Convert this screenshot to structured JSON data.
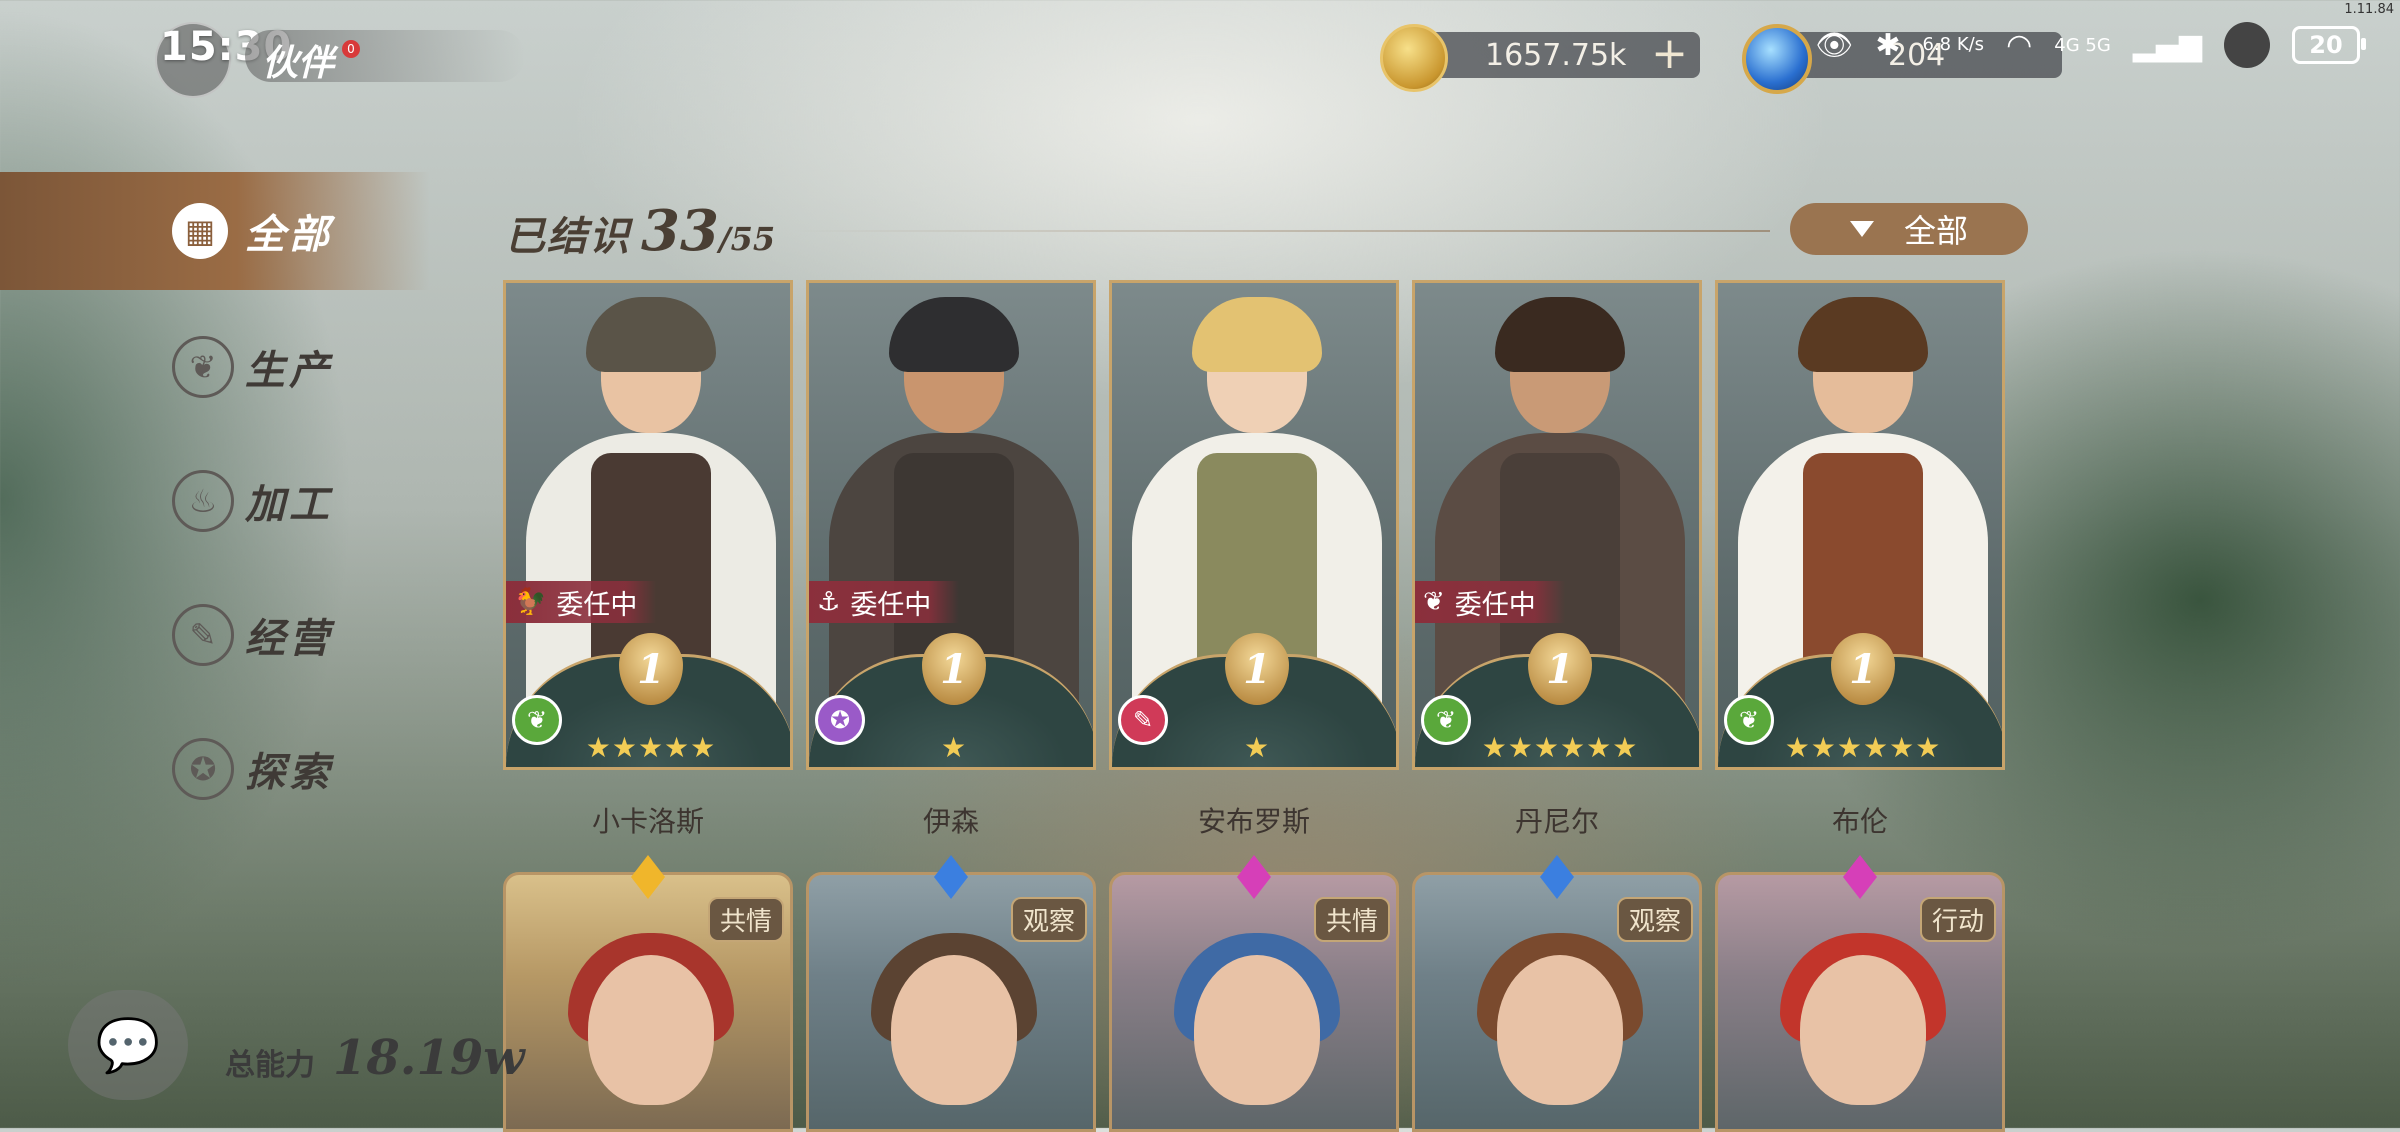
{
  "status_bar": {
    "time": "15:30",
    "net_speed": "6.8 K/s",
    "network": "4G 5G",
    "battery": "20",
    "version": "1.11.84"
  },
  "header": {
    "title": "伙伴",
    "badge": "0",
    "gold_amount": "1657.75k",
    "gem_amount": "204"
  },
  "sidebar": {
    "items": [
      {
        "label": "全部",
        "icon": "grid-icon"
      },
      {
        "label": "生产",
        "icon": "wheat-icon"
      },
      {
        "label": "加工",
        "icon": "pot-icon"
      },
      {
        "label": "经营",
        "icon": "scroll-icon"
      },
      {
        "label": "探索",
        "icon": "compass-icon"
      }
    ]
  },
  "roster": {
    "known_label": "已结识",
    "known_count": "33",
    "known_total": "/55",
    "filter_label": "全部"
  },
  "partners": [
    {
      "name": "小卡洛斯",
      "level": "1",
      "stars": "★★★★★",
      "task": "委任中",
      "task_icon": "rooster-icon",
      "type_icon": "wheat-icon",
      "type_color": "#5aa83b",
      "skin": "#e9c3a3",
      "hair": "#5a5448",
      "body": "#ecebe4",
      "vest": "#4a3a33"
    },
    {
      "name": "伊森",
      "level": "1",
      "stars": "★",
      "task": "委任中",
      "task_icon": "anchor-icon",
      "type_icon": "compass-icon",
      "type_color": "#9a5ac8",
      "skin": "#c9956e",
      "hair": "#2e2e30",
      "body": "#4c4540",
      "vest": "#3d3733"
    },
    {
      "name": "安布罗斯",
      "level": "1",
      "stars": "★",
      "task": "",
      "task_icon": "",
      "type_icon": "scroll-icon",
      "type_color": "#d03a58",
      "skin": "#efd0b5",
      "hair": "#e3c272",
      "body": "#f1efe8",
      "vest": "#8a8a5e"
    },
    {
      "name": "丹尼尔",
      "level": "1",
      "stars": "★★★★★★",
      "task": "委任中",
      "task_icon": "wheat-icon",
      "type_icon": "wheat-icon",
      "type_color": "#5aa83b",
      "skin": "#c99a76",
      "hair": "#3a2a20",
      "body": "#5b4c44",
      "vest": "#4a3f39"
    },
    {
      "name": "布伦",
      "level": "1",
      "stars": "★★★★★★",
      "task": "",
      "task_icon": "",
      "type_icon": "wheat-icon",
      "type_color": "#5aa83b",
      "skin": "#e5bc9a",
      "hair": "#5a3a22",
      "body": "#f3f1ea",
      "vest": "#8a4a2e"
    }
  ],
  "partners_row2": [
    {
      "trait": "共情",
      "style": "gold",
      "gem_color": "#f0b62b",
      "hair": "#a8352c"
    },
    {
      "trait": "观察",
      "style": "blue",
      "gem_color": "#3b7fe0",
      "hair": "#5b4332"
    },
    {
      "trait": "共情",
      "style": "pink",
      "gem_color": "#d63fb8",
      "hair": "#3f6aa5"
    },
    {
      "trait": "观察",
      "style": "blue",
      "gem_color": "#3b7fe0",
      "hair": "#7a4a2e"
    },
    {
      "trait": "行动",
      "style": "pink",
      "gem_color": "#d63fb8",
      "hair": "#c2352b"
    }
  ],
  "footer": {
    "power_label": "总能力",
    "power_value": "18.19w"
  },
  "colors": {
    "accent_brown": "#9a7450",
    "card_border": "#c8a46a",
    "task_tag": "#8b2f3c",
    "star": "#f2cc55"
  }
}
